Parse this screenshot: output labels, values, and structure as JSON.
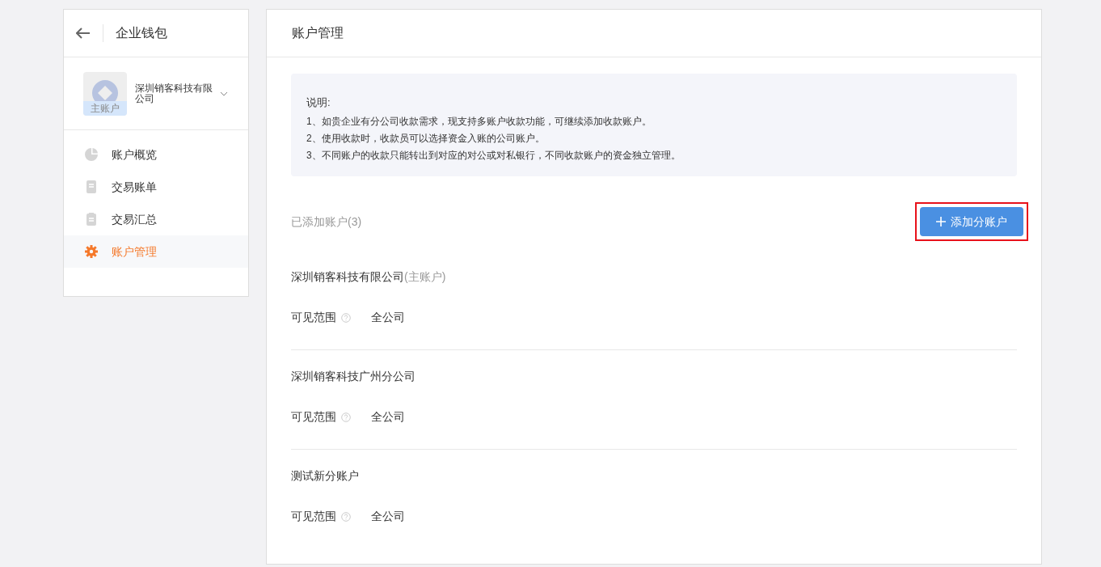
{
  "sidebar": {
    "title": "企业钱包",
    "company": {
      "name": "深圳销客科技有限公司",
      "badge": "主账户"
    },
    "items": [
      {
        "label": "账户概览",
        "selected": false
      },
      {
        "label": "交易账单",
        "selected": false
      },
      {
        "label": "交易汇总",
        "selected": false
      },
      {
        "label": "账户管理",
        "selected": true
      }
    ]
  },
  "main": {
    "title": "账户管理",
    "notice": {
      "heading": "说明:",
      "lines": [
        "1、如贵企业有分公司收款需求，现支持多账户收款功能，可继续添加收款账户。",
        "2、使用收款时，收款员可以选择资金入账的公司账户。",
        "3、不同账户的收款只能转出到对应的对公或对私银行，不同收款账户的资金独立管理。"
      ]
    },
    "count_label": "已添加账户(3)",
    "add_button": "添加分账户",
    "highlighted": true,
    "accounts": [
      {
        "name": "深圳销客科技有限公司",
        "tag": "(主账户)",
        "scope_label": "可见范围",
        "scope": "全公司"
      },
      {
        "name": "深圳销客科技广州分公司",
        "scope_label": "可见范围",
        "scope": "全公司"
      },
      {
        "name": "测试新分账户",
        "scope_label": "可见范围",
        "scope": "全公司"
      }
    ]
  }
}
